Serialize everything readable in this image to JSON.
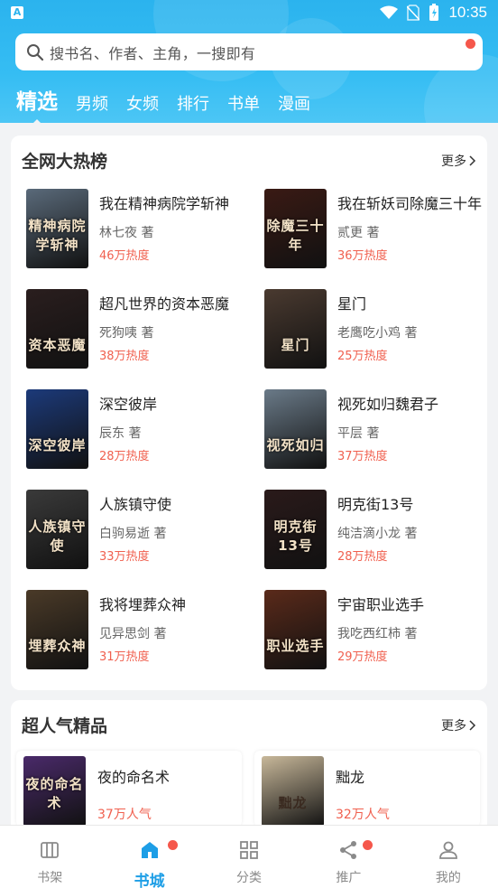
{
  "status_bar": {
    "time": "10:35",
    "app_badge": "A"
  },
  "search": {
    "placeholder": "搜书名、作者、主角，一搜即有"
  },
  "tabs": [
    {
      "label": "精选",
      "active": true
    },
    {
      "label": "男频"
    },
    {
      "label": "女频"
    },
    {
      "label": "排行"
    },
    {
      "label": "书单"
    },
    {
      "label": "漫画"
    }
  ],
  "hot_list": {
    "title": "全网大热榜",
    "more": "更多",
    "books": [
      {
        "name": "我在精神病院学斩神",
        "author": "林七夜 著",
        "heat": "46万热度",
        "cover_text": "精神病院学斩神",
        "cover_color": "#5a6a7a"
      },
      {
        "name": "我在斩妖司除魔三十年",
        "author": "贰更 著",
        "heat": "36万热度",
        "cover_text": "除魔三十年",
        "cover_color": "#3a1a14"
      },
      {
        "name": "超凡世界的资本恶魔",
        "author": "死狗咦 著",
        "heat": "38万热度",
        "cover_text": "资本恶魔",
        "cover_color": "#2a1e1e"
      },
      {
        "name": "星门",
        "author": "老鹰吃小鸡 著",
        "heat": "25万热度",
        "cover_text": "星门",
        "cover_color": "#4a3a30"
      },
      {
        "name": "深空彼岸",
        "author": "辰东 著",
        "heat": "28万热度",
        "cover_text": "深空彼岸",
        "cover_color": "#1c3a7a"
      },
      {
        "name": "视死如归魏君子",
        "author": "平层 著",
        "heat": "37万热度",
        "cover_text": "视死如归",
        "cover_color": "#6a7a88"
      },
      {
        "name": "人族镇守使",
        "author": "白驹易逝 著",
        "heat": "33万热度",
        "cover_text": "人族镇守使",
        "cover_color": "#3a3a3a"
      },
      {
        "name": "明克街13号",
        "author": "纯洁滴小龙 著",
        "heat": "28万热度",
        "cover_text": "明克街13号",
        "cover_color": "#2a1a1a"
      },
      {
        "name": "我将埋葬众神",
        "author": "见异思剑 著",
        "heat": "31万热度",
        "cover_text": "埋葬众神",
        "cover_color": "#4a3a28"
      },
      {
        "name": "宇宙职业选手",
        "author": "我吃西红柿 著",
        "heat": "29万热度",
        "cover_text": "职业选手",
        "cover_color": "#5a2a1a"
      }
    ]
  },
  "popular": {
    "title": "超人气精品",
    "more": "更多",
    "books": [
      {
        "name": "夜的命名术",
        "heat": "37万人气",
        "cover_text": "夜的命名术",
        "cover_color": "#4a2a6a"
      },
      {
        "name": "黜龙",
        "heat": "32万人气",
        "cover_text": "黜龙",
        "cover_color": "#c8b89a"
      }
    ]
  },
  "bottom_nav": [
    {
      "label": "书架",
      "icon": "bookshelf-icon"
    },
    {
      "label": "书城",
      "icon": "home-icon",
      "active": true,
      "dot": true
    },
    {
      "label": "分类",
      "icon": "category-icon"
    },
    {
      "label": "推广",
      "icon": "share-icon",
      "dot": true
    },
    {
      "label": "我的",
      "icon": "profile-icon"
    }
  ],
  "colors": {
    "accent": "#1d9ee6",
    "header": "#35bdf3",
    "heat": "#f0604f",
    "badge_dot": "#f5574b"
  }
}
